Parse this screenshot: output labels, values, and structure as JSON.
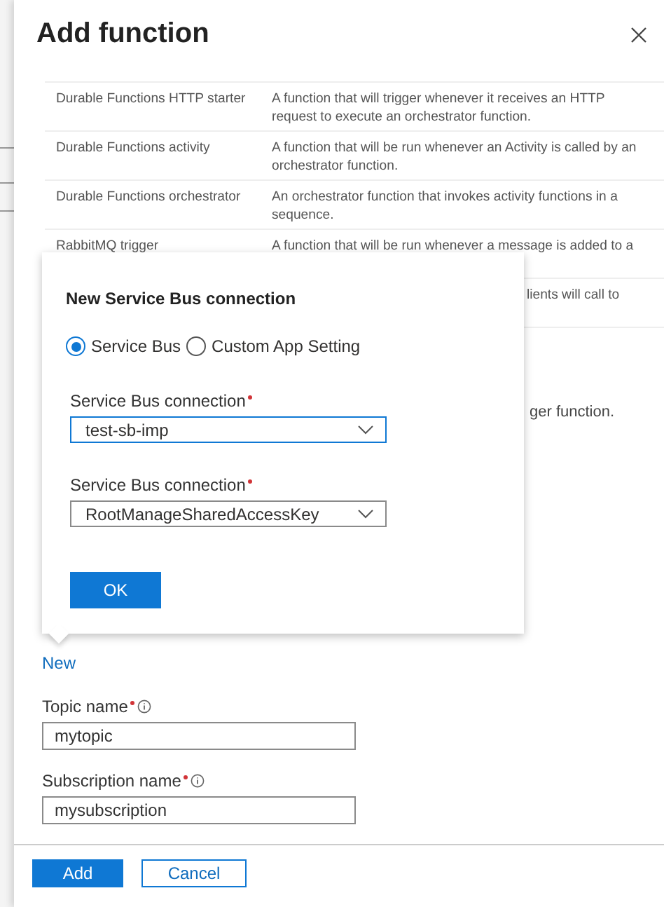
{
  "panel": {
    "title": "Add function"
  },
  "templates": [
    {
      "name": "Durable Functions HTTP starter",
      "description": "A function that will trigger whenever it receives an HTTP request to execute an orchestrator function."
    },
    {
      "name": "Durable Functions activity",
      "description": "A function that will be run whenever an Activity is called by an orchestrator function."
    },
    {
      "name": "Durable Functions orchestrator",
      "description": "An orchestrator function that invokes activity functions in a sequence."
    },
    {
      "name": "RabbitMQ trigger",
      "description": "A function that will be run whenever a message is added to a"
    },
    {
      "description": "lients will call to"
    }
  ],
  "description_fragment": "ger function.",
  "new_link": "New",
  "fields": [
    {
      "label": "Topic name",
      "required": true,
      "value": "mytopic"
    },
    {
      "label": "Subscription name",
      "required": true,
      "value": "mysubscription"
    }
  ],
  "buttons": [
    {
      "label": "Add",
      "kind": "primary"
    },
    {
      "label": "Cancel",
      "kind": "secondary"
    }
  ],
  "popup": {
    "title": "New Service Bus connection",
    "options": [
      {
        "label": "Service Bus",
        "selected": true
      },
      {
        "label": "Custom App Setting",
        "selected": false
      }
    ],
    "selects": [
      {
        "label": "Service Bus connection",
        "required": true,
        "value": "test-sb-imp",
        "focused": true
      },
      {
        "label": "Service Bus connection",
        "required": true,
        "value": "RootManageSharedAccessKey",
        "focused": false
      }
    ],
    "ok": "OK"
  }
}
